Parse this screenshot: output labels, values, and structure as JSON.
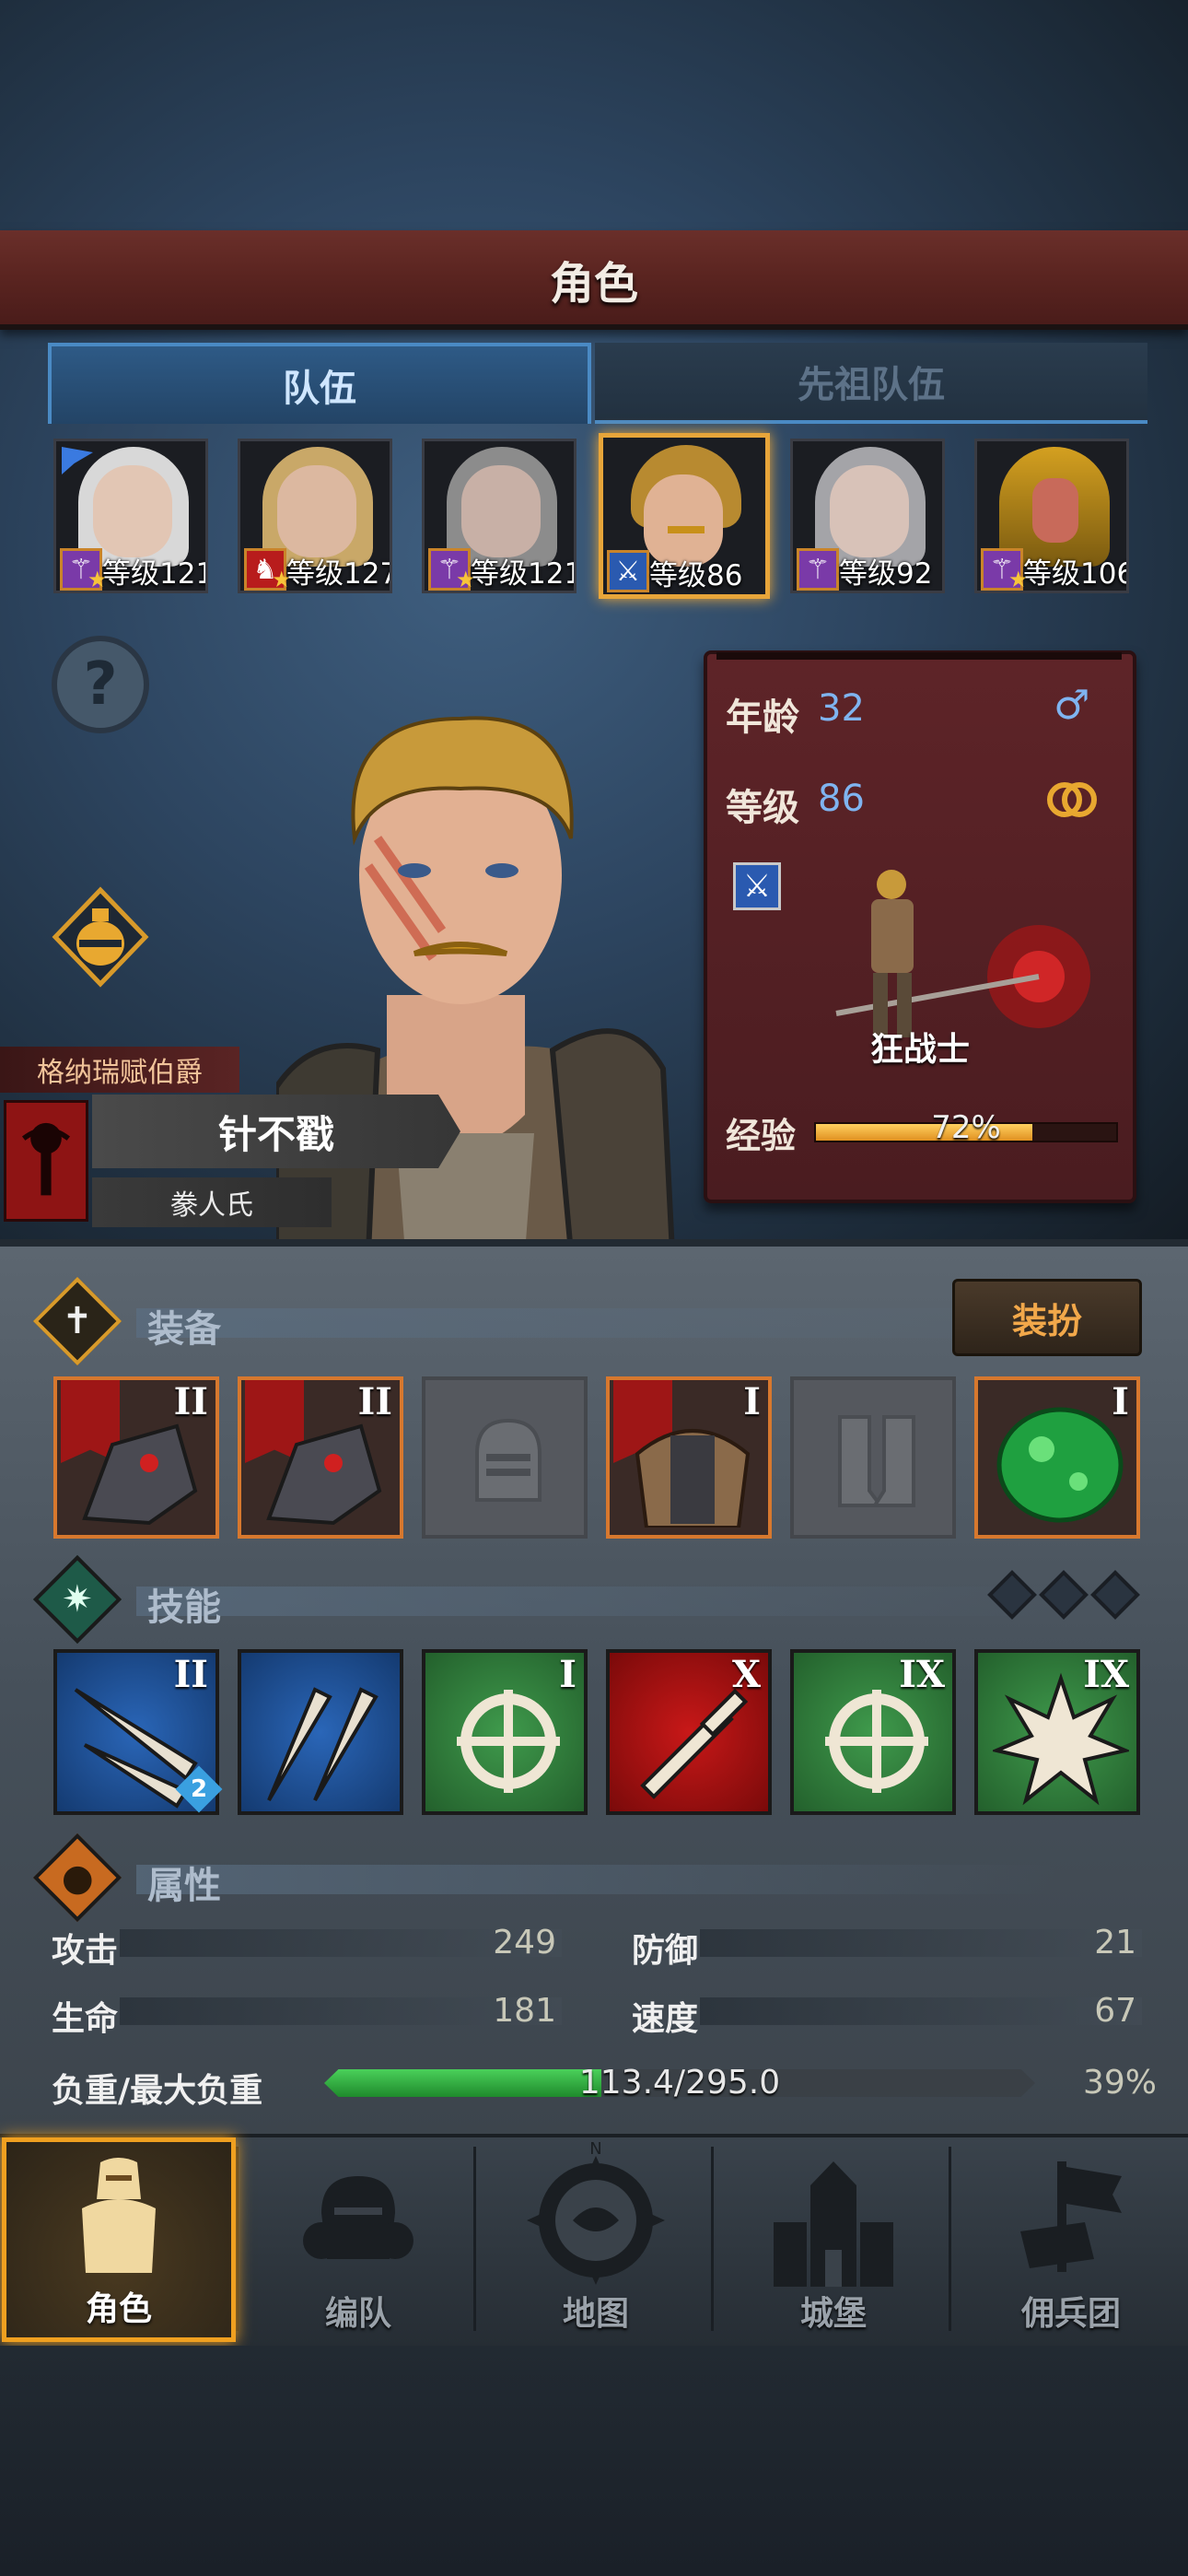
{
  "header": {
    "title": "角色"
  },
  "tabs": [
    {
      "label": "队伍",
      "active": true
    },
    {
      "label": "先祖队伍",
      "active": false
    }
  ],
  "roster": [
    {
      "level_text": "等级121",
      "class_icon": "staff-icon",
      "badge_color": "#7a3aa8",
      "selected": false
    },
    {
      "level_text": "等级127",
      "class_icon": "horse-icon",
      "badge_color": "#b81c1c",
      "selected": false
    },
    {
      "level_text": "等级121",
      "class_icon": "staff-icon",
      "badge_color": "#7a3aa8",
      "selected": false
    },
    {
      "level_text": "等级86",
      "class_icon": "sword-icon",
      "badge_color": "#2a5ab0",
      "selected": true
    },
    {
      "level_text": "等级92",
      "class_icon": "staff-icon",
      "badge_color": "#7a3aa8",
      "selected": false
    },
    {
      "level_text": "等级106",
      "class_icon": "staff-icon",
      "badge_color": "#7a3aa8",
      "selected": false
    }
  ],
  "character": {
    "noble_title": "格纳瑞赋伯爵",
    "name": "针不戳",
    "clan": "豢人氏",
    "age_label": "年龄",
    "age": "32",
    "level_label": "等级",
    "level": "86",
    "class_name": "狂战士",
    "exp_label": "经验",
    "exp_text": "72%",
    "exp_fraction": 0.72,
    "gender_icon": "male-icon",
    "trait_icon": "rings-icon"
  },
  "equipment": {
    "title": "装备",
    "dress_label": "装扮",
    "slots": [
      {
        "filled": true,
        "tier": "II",
        "item": "gauntlet-icon"
      },
      {
        "filled": true,
        "tier": "II",
        "item": "gauntlet-icon"
      },
      {
        "filled": false,
        "tier": "",
        "item": "helmet-icon"
      },
      {
        "filled": true,
        "tier": "I",
        "item": "armor-icon"
      },
      {
        "filled": false,
        "tier": "",
        "item": "boots-icon"
      },
      {
        "filled": true,
        "tier": "I",
        "item": "jade-charm-icon"
      }
    ]
  },
  "skills": {
    "title": "技能",
    "slots": [
      {
        "color": "blue",
        "tier": "II",
        "icon": "claw-slash-icon",
        "badge": "2"
      },
      {
        "color": "blue",
        "tier": "",
        "icon": "claw-slash-icon",
        "badge": ""
      },
      {
        "color": "green",
        "tier": "I",
        "icon": "crosshair-icon",
        "badge": ""
      },
      {
        "color": "red",
        "tier": "X",
        "icon": "sword-icon",
        "badge": ""
      },
      {
        "color": "green",
        "tier": "IX",
        "icon": "crosshair-icon",
        "badge": ""
      },
      {
        "color": "green",
        "tier": "IX",
        "icon": "burst-icon",
        "badge": ""
      }
    ]
  },
  "attributes": {
    "title": "属性",
    "attack_label": "攻击",
    "attack": "249",
    "defense_label": "防御",
    "defense": "21",
    "hp_label": "生命",
    "hp": "181",
    "speed_label": "速度",
    "speed": "67",
    "load_label": "负重/最大负重",
    "load_text": "113.4/295.0",
    "load_percent": "39%",
    "load_fraction": 0.39
  },
  "nav": [
    {
      "label": "角色",
      "active": true
    },
    {
      "label": "编队",
      "active": false
    },
    {
      "label": "地图",
      "active": false
    },
    {
      "label": "城堡",
      "active": false
    },
    {
      "label": "佣兵团",
      "active": false
    }
  ],
  "colors": {
    "accent": "#f0a020",
    "exp_bar": "#f2b33a",
    "load_bar": "#2fa840",
    "selected_border": "#e7a53a"
  }
}
